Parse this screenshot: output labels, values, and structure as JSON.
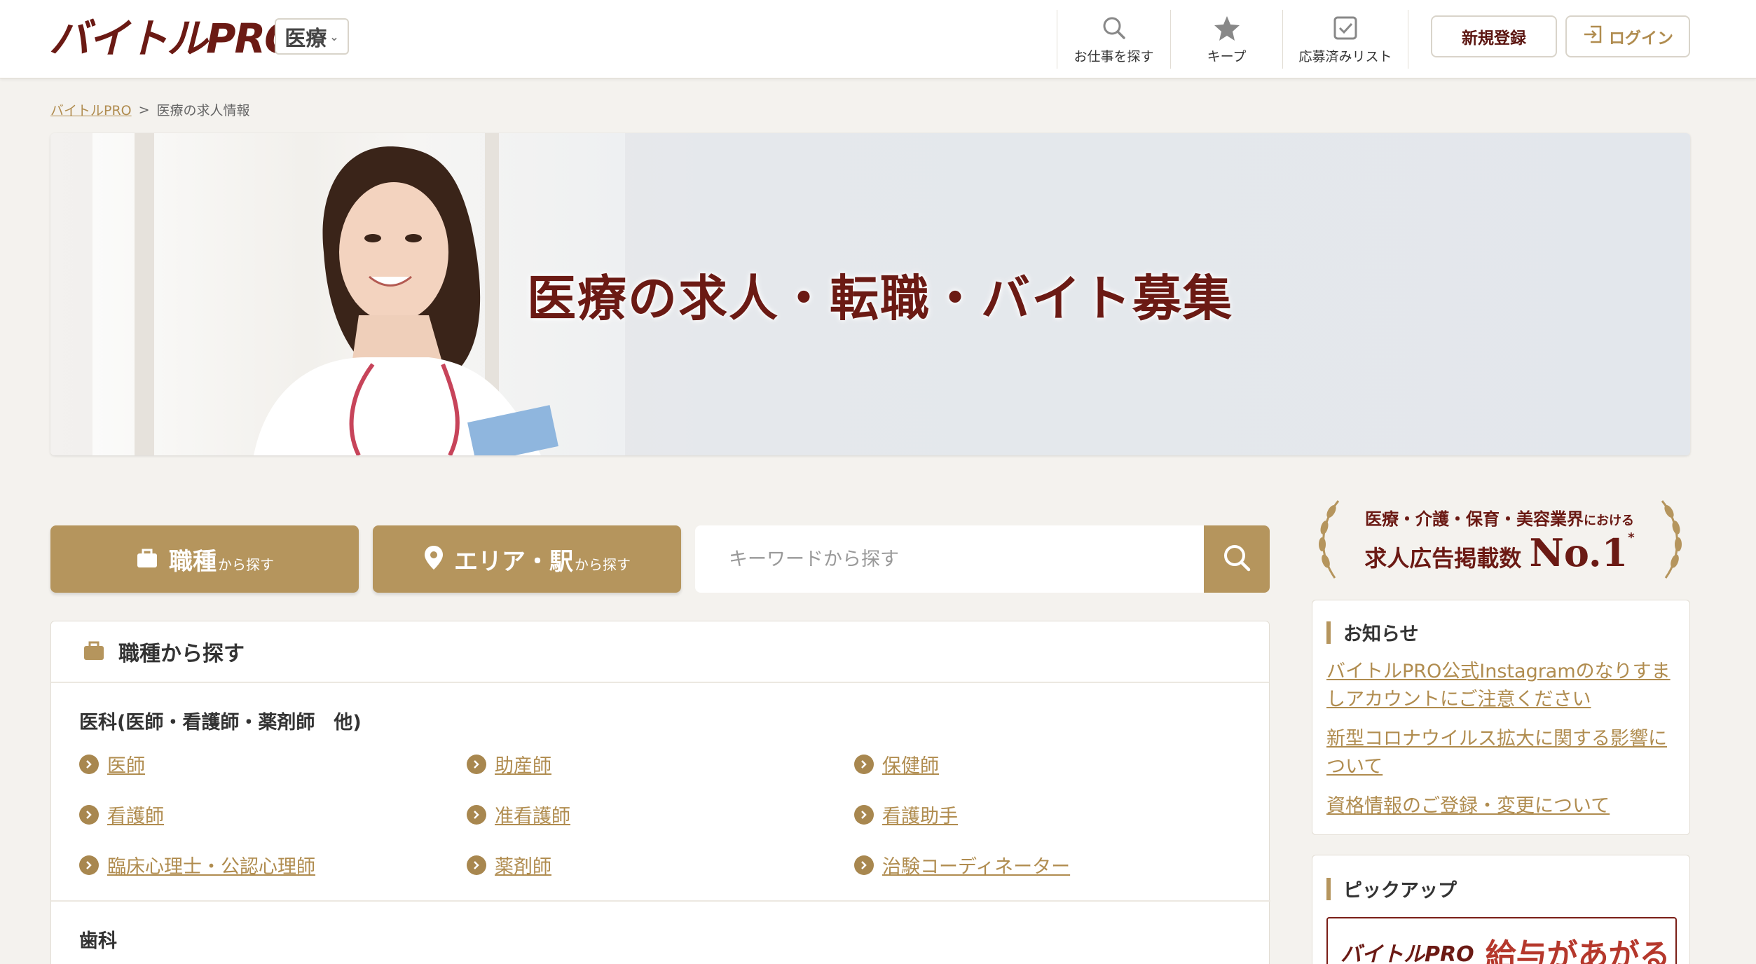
{
  "header": {
    "logo": "バイトルPRO",
    "category": "医療",
    "nav": {
      "search": "お仕事を探す",
      "keep": "キープ",
      "applied": "応募済みリスト"
    },
    "register": "新規登録",
    "login": "ログイン"
  },
  "breadcrumb": {
    "home": "バイトルPRO",
    "separator": ">",
    "current": "医療の求人情報"
  },
  "hero": {
    "title": "医療の求人・転職・バイト募集"
  },
  "search": {
    "job_tab": {
      "main": "職種",
      "sub": "から探す"
    },
    "area_tab": {
      "main": "エリア・駅",
      "sub": "から探す"
    },
    "keyword_placeholder": "キーワードから探す"
  },
  "job_panel": {
    "title": "職種から探す",
    "groups": [
      {
        "title": "医科(医師・看護師・薬剤師　他)",
        "links": [
          "医師",
          "助産師",
          "保健師",
          "看護師",
          "准看護師",
          "看護助手",
          "臨床心理士・公認心理師",
          "薬剤師",
          "治験コーディネーター"
        ]
      },
      {
        "title": "歯科",
        "links": []
      }
    ]
  },
  "award": {
    "line1_main": "医療・介護・保育・美容業界",
    "line1_suffix": "における",
    "line2": "求人広告掲載数",
    "no1": "No.1",
    "mark": "*"
  },
  "notice": {
    "title": "お知らせ",
    "links": [
      "バイトルPRO公式Instagramのなりすましアカウントにご注意ください",
      "新型コロナウイルス拡大に関する影響について",
      "資格情報のご登録・変更について"
    ]
  },
  "pickup": {
    "title": "ピックアップ",
    "banner_logo": "バイトルPRO",
    "banner_text": "給与があがる"
  },
  "colors": {
    "brand": "#6b1a14",
    "accent": "#b5955d",
    "link": "#b08c4f",
    "background": "#f4f2ee"
  }
}
